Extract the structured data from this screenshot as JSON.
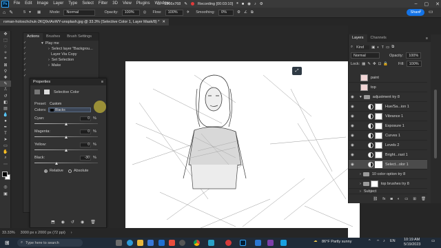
{
  "app": {
    "logo": "Ps"
  },
  "menu": [
    "File",
    "Edit",
    "Image",
    "Layer",
    "Type",
    "Select",
    "Filter",
    "3D",
    "View",
    "Plugins",
    "Window"
  ],
  "recording": {
    "resolution": "1366x768",
    "status": "Recording [00:03:10]"
  },
  "options": {
    "mode_label": "Mode:",
    "mode_value": "Normal",
    "opacity_label": "Opacity:",
    "opacity_value": "100%",
    "flow_label": "Flow:",
    "flow_value": "100%",
    "smoothing_label": "Smoothing:",
    "smoothing_value": "0%",
    "share_label": "Share",
    "brush_size": "5"
  },
  "document": {
    "tab_title": "roman-holoschchuk-2KQ9vIAxWY-unsplash.jpg @ 33.3% (Selective Color 1, Layer Mask/8) *"
  },
  "actions_panel": {
    "tabs": [
      "Actions",
      "Brushes",
      "Brush Settings"
    ],
    "rows": [
      "Play me",
      "Select layer \"Backgrou...",
      "Layer Via Copy",
      "Set Selection",
      "Make"
    ]
  },
  "properties": {
    "title": "Properties",
    "subtitle": "Selective Color",
    "preset_label": "Preset:",
    "preset_value": "Custom",
    "colors_label": "Colors:",
    "colors_value": "Blacks",
    "sliders": [
      {
        "label": "Cyan:",
        "value": "0",
        "unit": "%",
        "level": 0.5
      },
      {
        "label": "Magenta:",
        "value": "0",
        "unit": "%",
        "level": 0.5
      },
      {
        "label": "Yellow:",
        "value": "0",
        "unit": "%",
        "level": 0.5
      },
      {
        "label": "Black:",
        "value": "-30",
        "unit": "%",
        "level": 0.35
      }
    ],
    "method_relative": "Relative",
    "method_absolute": "Absolute"
  },
  "layers_panel": {
    "tabs": [
      "Layers",
      "Channels"
    ],
    "kind_label": "Kind",
    "blend_mode": "Normal",
    "opacity_label": "Opacity:",
    "opacity_value": "100%",
    "lock_label": "Lock:",
    "fill_label": "Fill:",
    "fill_value": "100%",
    "layers": [
      {
        "name": "paint",
        "type": "pixel"
      },
      {
        "name": "top",
        "type": "pixel"
      },
      {
        "name": "adjustment try 8",
        "type": "group"
      },
      {
        "name": "Hue/Sa...ion 1",
        "type": "adjustment"
      },
      {
        "name": "Vibrance 1",
        "type": "adjustment"
      },
      {
        "name": "Exposure 1",
        "type": "adjustment"
      },
      {
        "name": "Curves 1",
        "type": "adjustment"
      },
      {
        "name": "Levels 2",
        "type": "adjustment"
      },
      {
        "name": "Bright...rast 1",
        "type": "adjustment"
      },
      {
        "name": "Select...olor 1",
        "type": "adjustment",
        "selected": true
      },
      {
        "name": "10 color option try 8",
        "type": "group"
      },
      {
        "name": "top brushes try 8",
        "type": "pixel"
      },
      {
        "name": "Subject",
        "type": "pixel"
      }
    ]
  },
  "status": {
    "zoom": "33.33%",
    "dimensions": "3000 px x 2000 px (72 ppi)"
  },
  "taskbar": {
    "search_placeholder": "Type here to search",
    "weather": "86°F  Partly sunny",
    "time": "10:19 AM",
    "date": "5/19/2023"
  }
}
